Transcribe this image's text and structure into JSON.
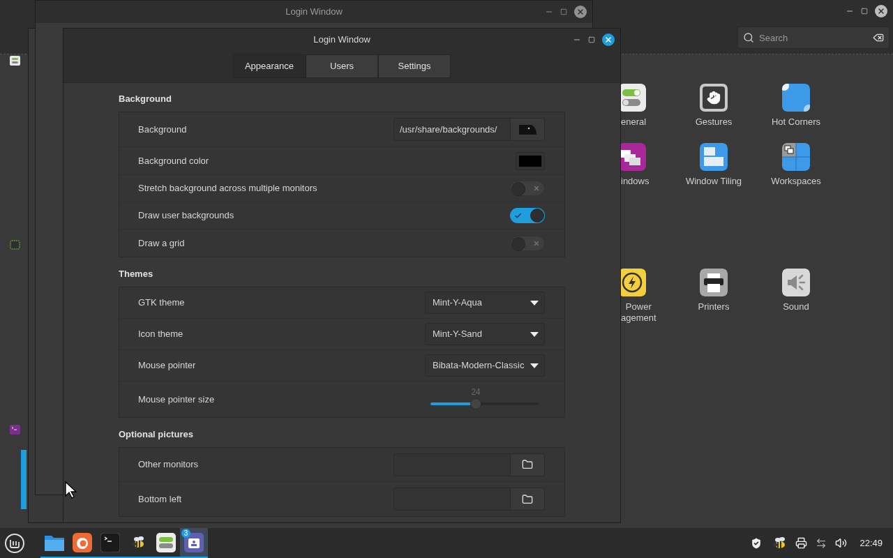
{
  "settings_window": {
    "search": {
      "placeholder": "Search"
    },
    "items": [
      {
        "kind": "toggles",
        "lines": [
          "eneral"
        ]
      },
      {
        "kind": "gestures",
        "lines": [
          "Gestures"
        ]
      },
      {
        "kind": "hot-corners",
        "lines": [
          "Hot Corners"
        ]
      },
      {
        "kind": "windows",
        "lines": [
          "indows"
        ]
      },
      {
        "kind": "tiling",
        "lines": [
          "Window Tiling"
        ]
      },
      {
        "kind": "workspaces",
        "lines": [
          "Workspaces"
        ]
      },
      {
        "kind": "power",
        "lines": [
          "Power",
          "agement"
        ]
      },
      {
        "kind": "printers",
        "lines": [
          "Printers"
        ]
      },
      {
        "kind": "sound",
        "lines": [
          "Sound"
        ]
      }
    ]
  },
  "back_window": {
    "title": "Login Window"
  },
  "dialog": {
    "title": "Login Window",
    "tabs": [
      {
        "label": "Appearance",
        "selected": true
      },
      {
        "label": "Users",
        "selected": false
      },
      {
        "label": "Settings",
        "selected": false
      }
    ],
    "sections": [
      {
        "title": "Background",
        "rows": [
          {
            "kind": "image-file",
            "label": "Background",
            "value": "/usr/share/backgrounds/"
          },
          {
            "kind": "color",
            "label": "Background color",
            "color": "#000000"
          },
          {
            "kind": "switch",
            "label": "Stretch background across multiple monitors",
            "on": false
          },
          {
            "kind": "switch",
            "label": "Draw user backgrounds",
            "on": true
          },
          {
            "kind": "switch",
            "label": "Draw a grid",
            "on": false
          }
        ]
      },
      {
        "title": "Themes",
        "rows": [
          {
            "kind": "dropdown",
            "label": "GTK theme",
            "value": "Mint-Y-Aqua"
          },
          {
            "kind": "dropdown",
            "label": "Icon theme",
            "value": "Mint-Y-Sand"
          },
          {
            "kind": "dropdown",
            "label": "Mouse pointer",
            "value": "Bibata-Modern-Classic"
          },
          {
            "kind": "slider",
            "label": "Mouse pointer size",
            "reading": "24",
            "level": 0.42
          }
        ]
      },
      {
        "title": "Optional pictures",
        "rows": [
          {
            "kind": "folder-file",
            "label": "Other monitors"
          },
          {
            "kind": "folder-file",
            "label": "Bottom left"
          }
        ]
      }
    ]
  },
  "taskbar": {
    "apps": [
      {
        "kind": "files",
        "selected": false
      },
      {
        "kind": "firefox",
        "selected": false
      },
      {
        "kind": "terminal",
        "selected": false
      },
      {
        "kind": "bee",
        "selected": false
      },
      {
        "kind": "toggles",
        "selected": false
      },
      {
        "kind": "window-list",
        "selected": true,
        "badge": "3"
      }
    ],
    "clock": "22:49"
  }
}
